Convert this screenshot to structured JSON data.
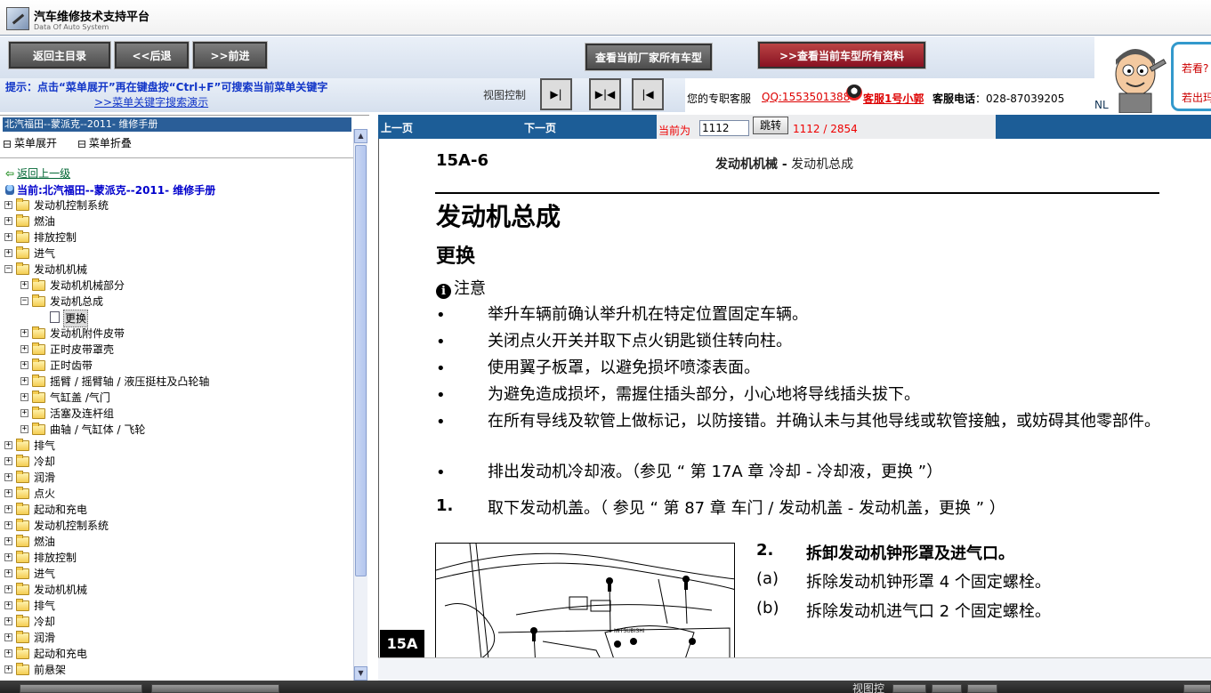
{
  "app": {
    "title": "汽车维修技术支持平台",
    "subtitle": "Data Of Auto System"
  },
  "toolbar": {
    "home": "返回主目录",
    "back": "<<后退",
    "forward": ">>前进",
    "all_models": "查看当前厂家所有车型",
    "all_docs": ">>查看当前车型所有资料"
  },
  "hint": {
    "line1": "提示：点击“菜单展开”再在键盘按“Ctrl+F”可搜索当前菜单关键字",
    "line2": ">>菜单关键字搜索演示"
  },
  "view_control": {
    "label": "视图控制",
    "btn1": "▶|",
    "btn2": "▶|◀",
    "btn3": "|◀"
  },
  "service": {
    "label": "您的专职客服",
    "qq": "QQ:1553501388",
    "name": "客服1号小郭",
    "tel_label": "客服电话",
    "tel": "：028-87039205"
  },
  "ad": {
    "line1": "若看?",
    "line2": "若出玛",
    "nl": "NL"
  },
  "left": {
    "book": "北汽福田--蒙派克--2011- 维修手册",
    "expand": "菜单展开",
    "collapse": "菜单折叠",
    "back": "返回上一级",
    "current": "当前:北汽福田--蒙派克--2011- 维修手册",
    "tree": [
      {
        "label": "发动机控制系统",
        "level": 0,
        "type": "folder",
        "exp": "+"
      },
      {
        "label": "燃油",
        "level": 0,
        "type": "folder",
        "exp": "+"
      },
      {
        "label": "排放控制",
        "level": 0,
        "type": "folder",
        "exp": "+"
      },
      {
        "label": "进气",
        "level": 0,
        "type": "folder",
        "exp": "+"
      },
      {
        "label": "发动机机械",
        "level": 0,
        "type": "folder",
        "exp": "−"
      },
      {
        "label": "发动机机械部分",
        "level": 1,
        "type": "folder",
        "exp": "+"
      },
      {
        "label": "发动机总成",
        "level": 1,
        "type": "folder",
        "exp": "−"
      },
      {
        "label": "更换",
        "level": 2,
        "type": "doc",
        "exp": ""
      },
      {
        "label": "发动机附件皮带",
        "level": 1,
        "type": "folder",
        "exp": "+"
      },
      {
        "label": "正时皮带罩壳",
        "level": 1,
        "type": "folder",
        "exp": "+"
      },
      {
        "label": "正时齿带",
        "level": 1,
        "type": "folder",
        "exp": "+"
      },
      {
        "label": "摇臂 / 摇臂轴 / 液压挺柱及凸轮轴",
        "level": 1,
        "type": "folder",
        "exp": "+"
      },
      {
        "label": "气缸盖 /气门",
        "level": 1,
        "type": "folder",
        "exp": "+"
      },
      {
        "label": "活塞及连杆组",
        "level": 1,
        "type": "folder",
        "exp": "+"
      },
      {
        "label": "曲轴 / 气缸体 / 飞轮",
        "level": 1,
        "type": "folder",
        "exp": "+"
      },
      {
        "label": "排气",
        "level": 0,
        "type": "folder",
        "exp": "+"
      },
      {
        "label": "冷却",
        "level": 0,
        "type": "folder",
        "exp": "+"
      },
      {
        "label": "润滑",
        "level": 0,
        "type": "folder",
        "exp": "+"
      },
      {
        "label": "点火",
        "level": 0,
        "type": "folder",
        "exp": "+"
      },
      {
        "label": "起动和充电",
        "level": 0,
        "type": "folder",
        "exp": "+"
      },
      {
        "label": "发动机控制系统",
        "level": 0,
        "type": "folder",
        "exp": "+"
      },
      {
        "label": "燃油",
        "level": 0,
        "type": "folder",
        "exp": "+"
      },
      {
        "label": "排放控制",
        "level": 0,
        "type": "folder",
        "exp": "+"
      },
      {
        "label": "进气",
        "level": 0,
        "type": "folder",
        "exp": "+"
      },
      {
        "label": "发动机机械",
        "level": 0,
        "type": "folder",
        "exp": "+"
      },
      {
        "label": "排气",
        "level": 0,
        "type": "folder",
        "exp": "+"
      },
      {
        "label": "冷却",
        "level": 0,
        "type": "folder",
        "exp": "+"
      },
      {
        "label": "润滑",
        "level": 0,
        "type": "folder",
        "exp": "+"
      },
      {
        "label": "起动和充电",
        "level": 0,
        "type": "folder",
        "exp": "+"
      },
      {
        "label": "前悬架",
        "level": 0,
        "type": "folder",
        "exp": "+"
      }
    ]
  },
  "pager": {
    "prev": "上一页",
    "next": "下一页",
    "current_label": "当前为",
    "page_value": "1112",
    "go": "跳转",
    "total": "1112 / 2854"
  },
  "doc": {
    "page_no": "15A-6",
    "chapter_bold": "发动机机械 -",
    "chapter": " 发动机总成",
    "title": "发动机总成",
    "subtitle": "更换",
    "note": "注意",
    "bullets": [
      "举升车辆前确认举升机在特定位置固定车辆。",
      "关闭点火开关并取下点火钥匙锁住转向柱。",
      "使用翼子板罩，以避免损坏喷漆表面。",
      "为避免造成损坏，需握住插头部分，小心地将导线插头拔下。",
      "在所有导线及软管上做标记，以防接错。并确认未与其他导线或软管接触，或妨碍其他零部件。",
      "排出发动机冷却液。（参见 “ 第 17A 章 冷却 - 冷却液，更换 ”）"
    ],
    "step1_no": "1.",
    "step1": "取下发动机盖。（ 参见 “ 第 87 章 车门 / 发动机盖 - 发动机盖，更换 ” ）",
    "step2_no": "2.",
    "step2": "拆卸发动机钟形罩及进气口。",
    "sub_a_no": "(a)",
    "sub_a": "拆除发动机钟形罩 4 个固定螺栓。",
    "sub_b_no": "(b)",
    "sub_b": "拆除发动机进气口 2 个固定螺栓。",
    "side_tab": "15A"
  },
  "bottom": {
    "view": "视图控"
  }
}
